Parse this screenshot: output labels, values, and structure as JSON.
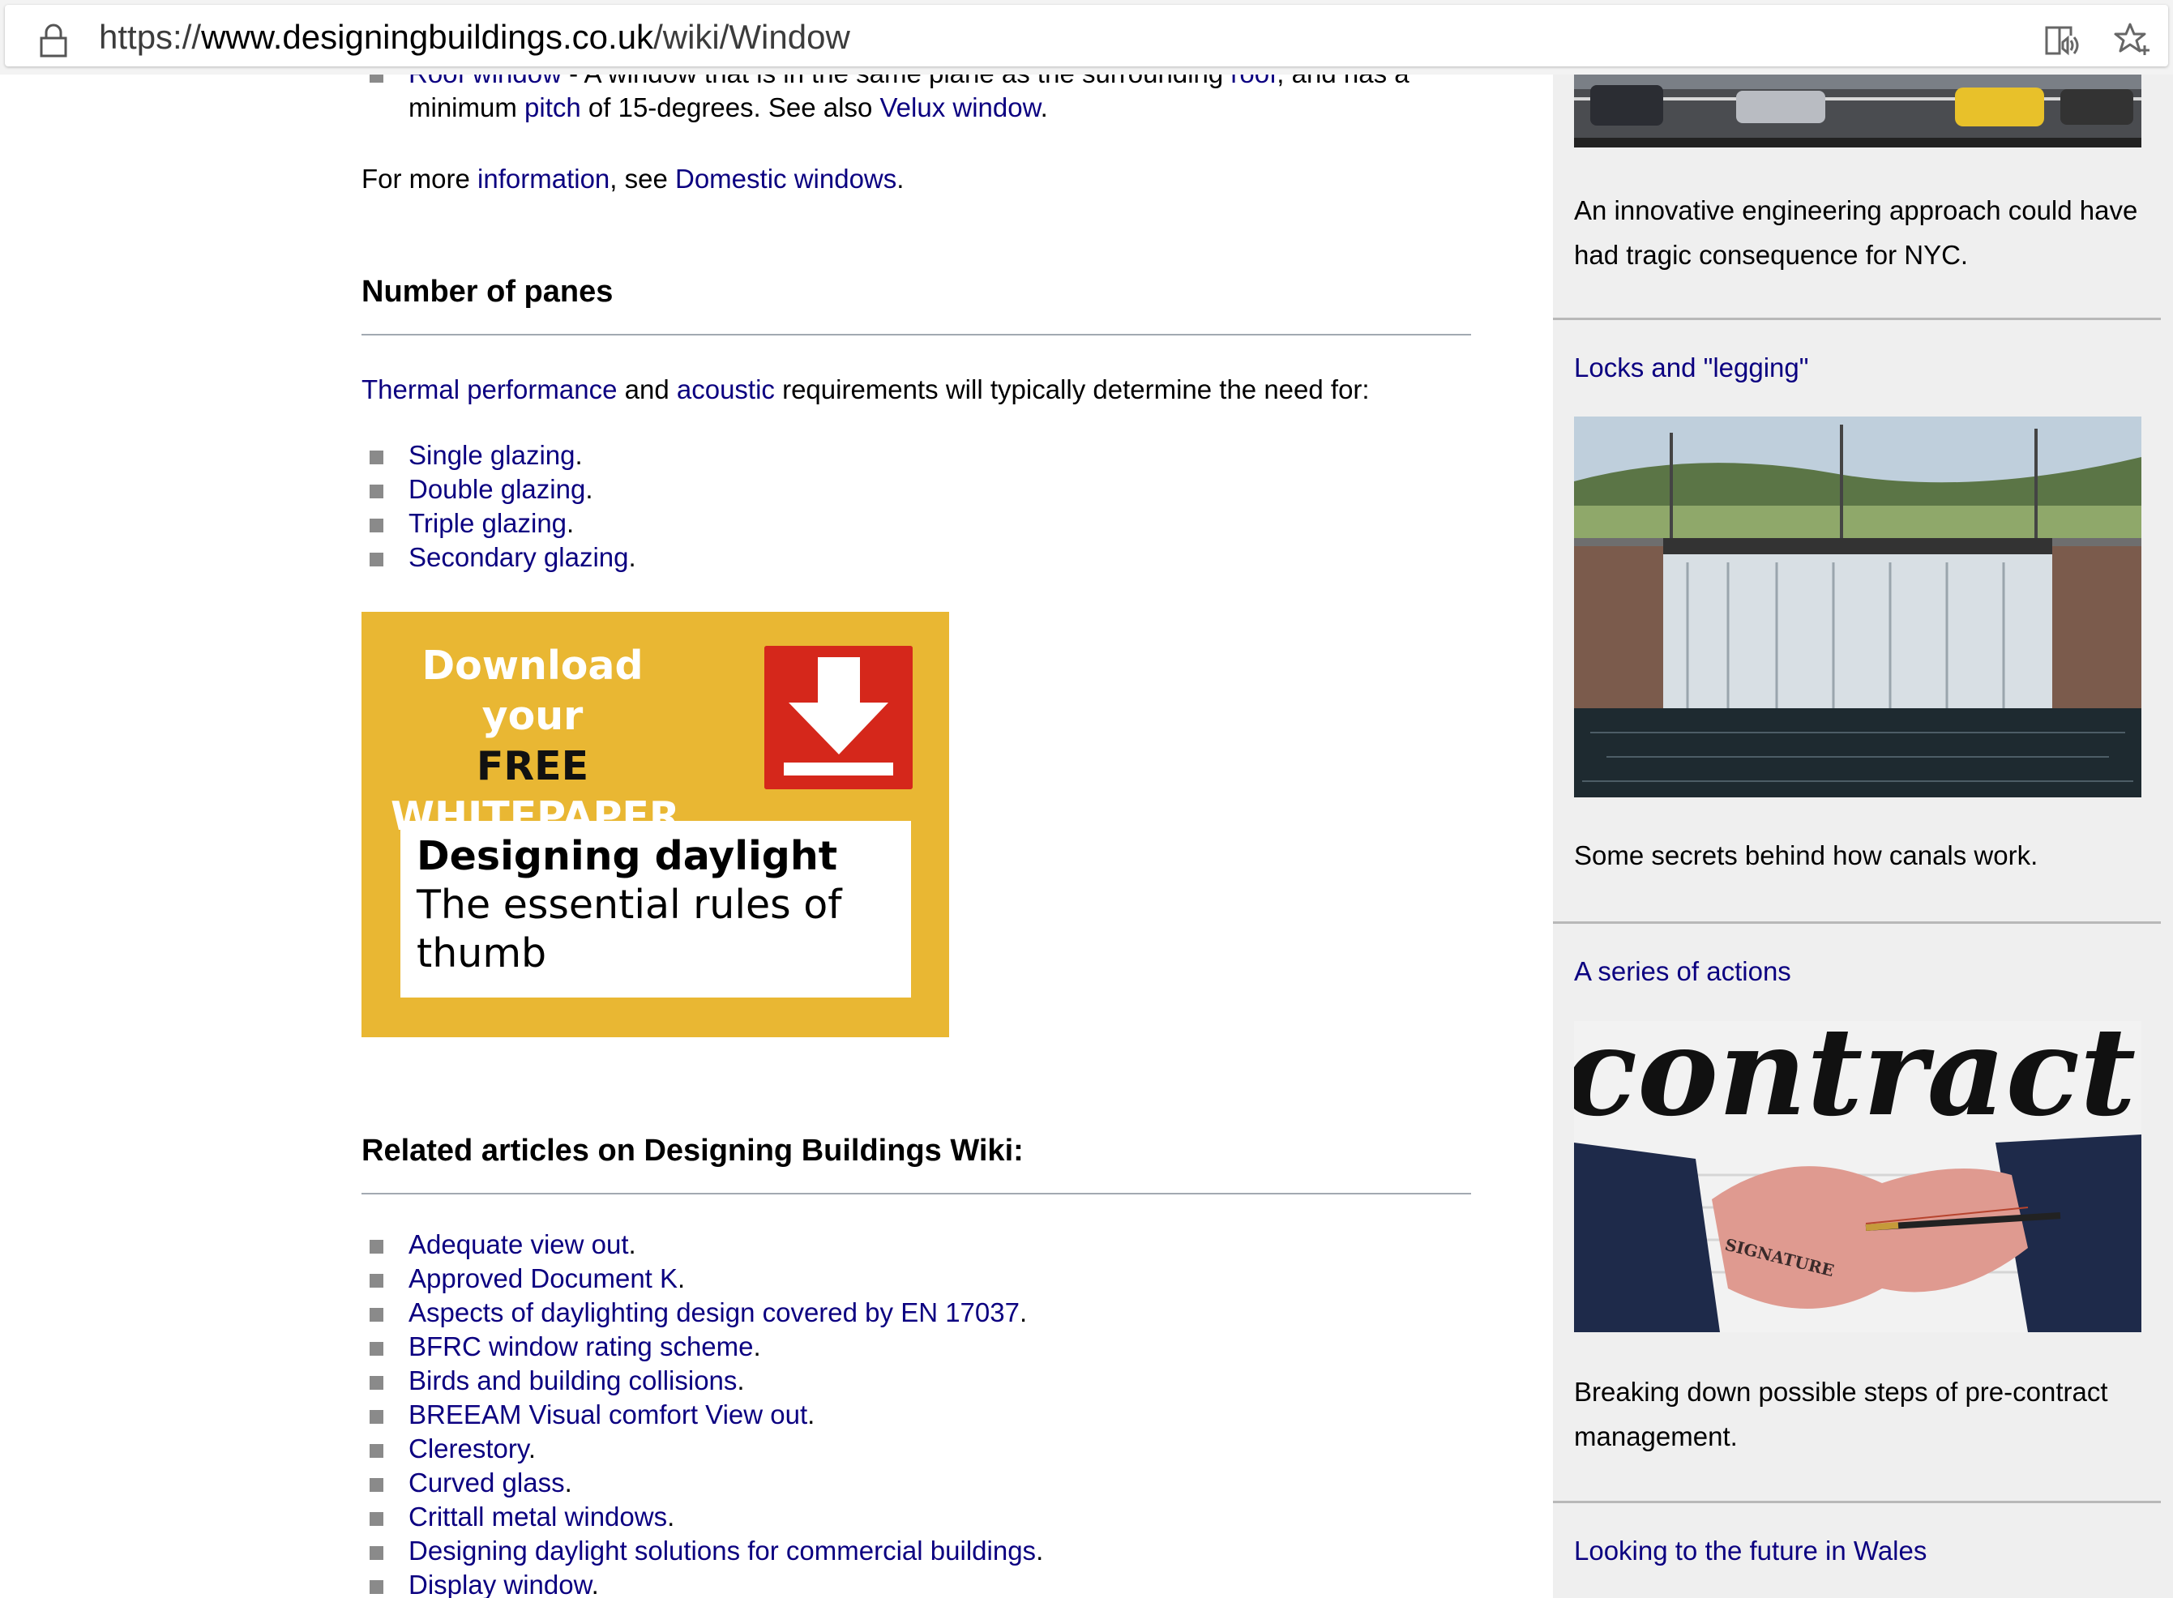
{
  "browser": {
    "url_prefix": "https://",
    "url_domain": "www.designingbuildings.co.uk",
    "url_path": "/wiki/Window",
    "icons": [
      "lock-icon",
      "reader-view-icon",
      "favorite-star-icon"
    ]
  },
  "article": {
    "roof_item": {
      "link": "Roof window",
      "text1": " - A window that is in the same plane as the surrounding ",
      "link2": "roof",
      "text2": ", and has a minimum ",
      "link3": "pitch",
      "text3": " of 15-degrees. See also ",
      "link4": "Velux window",
      "text4": "."
    },
    "more_info": {
      "text1": "For more ",
      "link1": "information",
      "text2": ", see ",
      "link2": "Domestic windows",
      "text3": "."
    },
    "panes": {
      "heading": "Number of panes",
      "intro_link1": "Thermal performance",
      "intro_text1": " and ",
      "intro_link2": "acoustic",
      "intro_text2": " requirements will typically determine the need for:",
      "items": [
        "Single glazing",
        "Double glazing",
        "Triple glazing",
        "Secondary glazing"
      ]
    },
    "whitepaper": {
      "line1": "Download your",
      "line2": "FREE",
      "line3": "WHITEPAPER",
      "title": "Designing daylight",
      "subtitle": "The essential rules of thumb",
      "colors": {
        "background": "#e9b733",
        "download_box": "#d5271b"
      }
    },
    "related": {
      "heading": "Related articles on Designing Buildings Wiki:",
      "items": [
        "Adequate view out",
        "Approved Document K",
        "Aspects of daylighting design covered by EN 17037",
        "BFRC window rating scheme",
        "Birds and building collisions",
        "BREEAM Visual comfort View out",
        "Clerestory",
        "Curved glass",
        "Crittall metal windows",
        "Designing daylight solutions for commercial buildings",
        "Display window"
      ]
    },
    "link_color": "#0b0080"
  },
  "sidebar": {
    "cards": [
      {
        "title": "",
        "text": "An innovative engineering approach could have had tragic consequence for NYC."
      },
      {
        "title": "Locks and \"legging\"",
        "text": "Some secrets behind how canals work."
      },
      {
        "title": "A series of actions",
        "image_word": "contract",
        "image_stamp": "SIGNATURE",
        "text": "Breaking down possible steps of pre-contract management."
      },
      {
        "title": "Looking to the future in Wales",
        "text": ""
      }
    ]
  }
}
